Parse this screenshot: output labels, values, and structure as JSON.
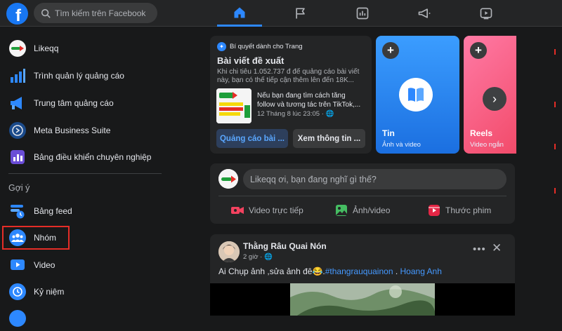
{
  "topbar": {
    "logo": "f",
    "search_placeholder": "Tìm kiếm trên Facebook",
    "tabs": [
      {
        "icon": "home-icon",
        "active": true
      },
      {
        "icon": "flag-icon",
        "active": false
      },
      {
        "icon": "chart-icon",
        "active": false
      },
      {
        "icon": "megaphone-icon",
        "active": false
      },
      {
        "icon": "video-play-icon",
        "active": false
      }
    ]
  },
  "sidebar": {
    "items": [
      {
        "label": "Likeqq",
        "icon": "page-avatar"
      },
      {
        "label": "Trình quản lý quảng cáo",
        "icon": "bar-chart-icon"
      },
      {
        "label": "Trung tâm quảng cáo",
        "icon": "megaphone-icon"
      },
      {
        "label": "Meta Business Suite",
        "icon": "business-suite-icon"
      },
      {
        "label": "Bảng điều khiển chuyên nghiệp",
        "icon": "dashboard-icon"
      }
    ],
    "section_heading": "Gợi ý",
    "suggestions": [
      {
        "label": "Bảng feed",
        "icon": "feed-icon"
      },
      {
        "label": "Nhóm",
        "icon": "groups-icon"
      },
      {
        "label": "Video",
        "icon": "video-icon"
      },
      {
        "label": "Kỷ niệm",
        "icon": "memories-icon"
      }
    ]
  },
  "promo": {
    "header": "Bí quyết dành cho Trang",
    "title": "Bài viết đề xuất",
    "desc_line1": "Khi chi tiêu 1.052.737 đ để quảng cáo bài viết",
    "desc_line2": "này, bạn có thể tiếp cận thêm lên đến 18K...",
    "post_line1": "Nếu bạn đang tìm cách tăng",
    "post_line2": "follow và tương tác trên TikTok,...",
    "post_time": "12 Tháng 8 lúc 23:05 · 🌐",
    "btn_primary": "Quảng cáo bài ...",
    "btn_secondary": "Xem thông tin ..."
  },
  "stories": [
    {
      "title": "Tin",
      "subtitle": "Ảnh và video"
    },
    {
      "title": "Reels",
      "subtitle": "Video ngắn"
    }
  ],
  "composer": {
    "placeholder": "Likeqq ơi, bạn đang nghĩ gì thế?",
    "actions": [
      {
        "label": "Video trực tiếp",
        "icon": "live-video-icon",
        "color": "#f3425f"
      },
      {
        "label": "Ảnh/video",
        "icon": "photo-icon",
        "color": "#45bd62"
      },
      {
        "label": "Thước phim",
        "icon": "reels-icon",
        "color": "#e42645"
      }
    ]
  },
  "post": {
    "author": "Thằng Râu Quai Nón",
    "time": "2 giờ · 🌐",
    "text_prefix": "Ai Chụp ảnh ,sửa ảnh đê😂.",
    "hashtag": "#thangrauquainon",
    "text_mid": " . ",
    "mention": "Hoang Anh"
  },
  "colors": {
    "accent": "#2d88ff",
    "highlight": "#e52d27"
  }
}
